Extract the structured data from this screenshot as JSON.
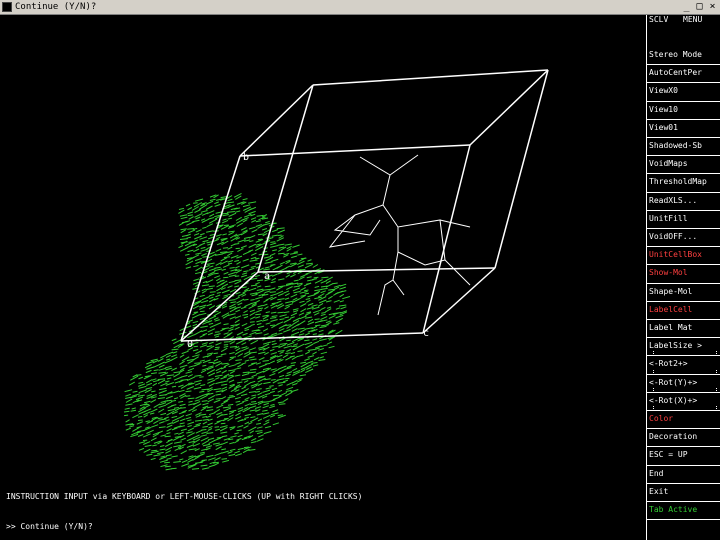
{
  "window": {
    "title": "Continue (Y/N)?",
    "minimize_glyph": "_",
    "maximize_glyph": "□",
    "close_glyph": "×"
  },
  "viewport": {
    "axis_labels": {
      "origin": "0",
      "a": "a",
      "b": "b",
      "c": "c"
    },
    "cell_color": "#ffffff",
    "density_color": "#33cc33",
    "console_line1": "INSTRUCTION INPUT via KEYBOARD or LEFT-MOUSE-CLICKS (UP with RIGHT CLICKS)",
    "console_line2": ">> Continue (Y/N)?"
  },
  "menu": {
    "header_left": "SCLV",
    "header_right": "MENU",
    "items": [
      {
        "label": "Stereo Mode",
        "color": "white"
      },
      {
        "label": "AutoCentPer",
        "color": "white"
      },
      {
        "label": "ViewX0",
        "color": "white"
      },
      {
        "label": "View10",
        "color": "white"
      },
      {
        "label": "View01",
        "color": "white"
      },
      {
        "label": "Shadowed-Sb",
        "color": "white"
      },
      {
        "label": "VoidMaps",
        "color": "white"
      },
      {
        "label": "ThresholdMap",
        "color": "white"
      },
      {
        "label": "ReadXLS...",
        "color": "white"
      },
      {
        "label": "UnitFill",
        "color": "white"
      },
      {
        "label": "VoidOFF...",
        "color": "white"
      },
      {
        "label": "UnitCellBox",
        "color": "red"
      },
      {
        "label": "Show-Mol",
        "color": "red"
      },
      {
        "label": "Shape-Mol",
        "color": "white"
      },
      {
        "label": "LabelCell",
        "color": "red"
      },
      {
        "label": "Label  Mat",
        "color": "white"
      },
      {
        "label": "LabelSize >",
        "color": "white"
      },
      {
        "label": "<-Rot2+>",
        "color": "white"
      },
      {
        "label": "<-Rot(Y)+>",
        "color": "white"
      },
      {
        "label": "<-Rot(X)+>",
        "color": "white"
      },
      {
        "label": "Color",
        "color": "red"
      },
      {
        "label": "Decoration",
        "color": "white"
      },
      {
        "label": "ESC = UP",
        "color": "white"
      },
      {
        "label": "End",
        "color": "white"
      },
      {
        "label": "Exit",
        "color": "white"
      },
      {
        "label": "Tab Active",
        "color": "green"
      }
    ]
  }
}
